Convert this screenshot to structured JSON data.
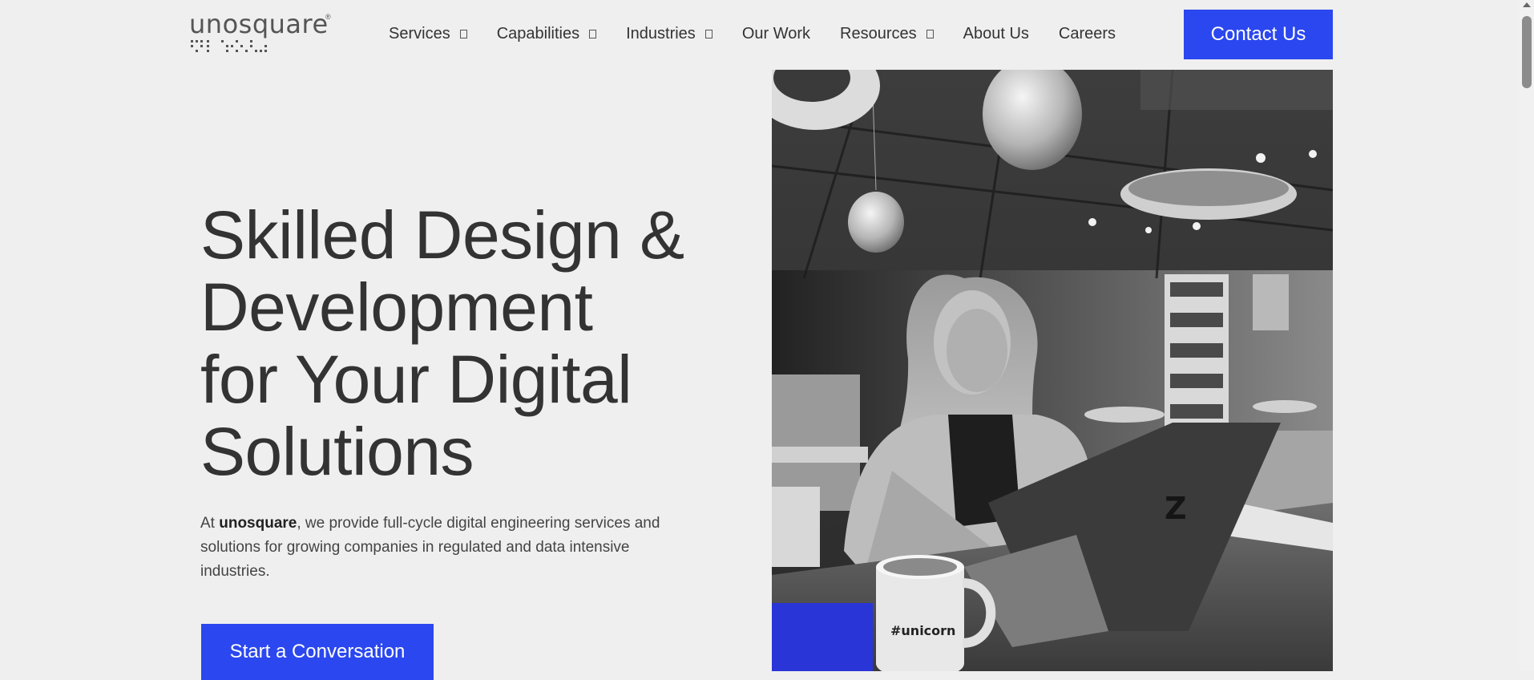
{
  "brand": {
    "name": "unosquare",
    "reg_mark": "®"
  },
  "nav": {
    "items": [
      {
        "label": "Services",
        "has_dropdown": true
      },
      {
        "label": "Capabilities",
        "has_dropdown": true
      },
      {
        "label": "Industries",
        "has_dropdown": true
      },
      {
        "label": "Our Work",
        "has_dropdown": false
      },
      {
        "label": "Resources",
        "has_dropdown": true
      },
      {
        "label": "About Us",
        "has_dropdown": false
      },
      {
        "label": "Careers",
        "has_dropdown": false
      }
    ],
    "contact_label": "Contact Us"
  },
  "hero": {
    "title_lines": [
      "Skilled Design &",
      "Development",
      "for Your Digital",
      "Solutions"
    ],
    "body_prefix": "At ",
    "body_brand": "unosquare",
    "body_suffix": ", we provide full-cycle digital engineering services and solutions for growing companies in regulated and data intensive industries.",
    "cta_label": "Start a Conversation",
    "mug_text": "#unicorn"
  },
  "colors": {
    "accent": "#2b47ef",
    "background": "#efefef",
    "text": "#333333",
    "photo_block": "#2a35d8"
  },
  "icons": {
    "dropdown": "chevron-down-icon",
    "logo_mark": "braille-dots-logo"
  }
}
